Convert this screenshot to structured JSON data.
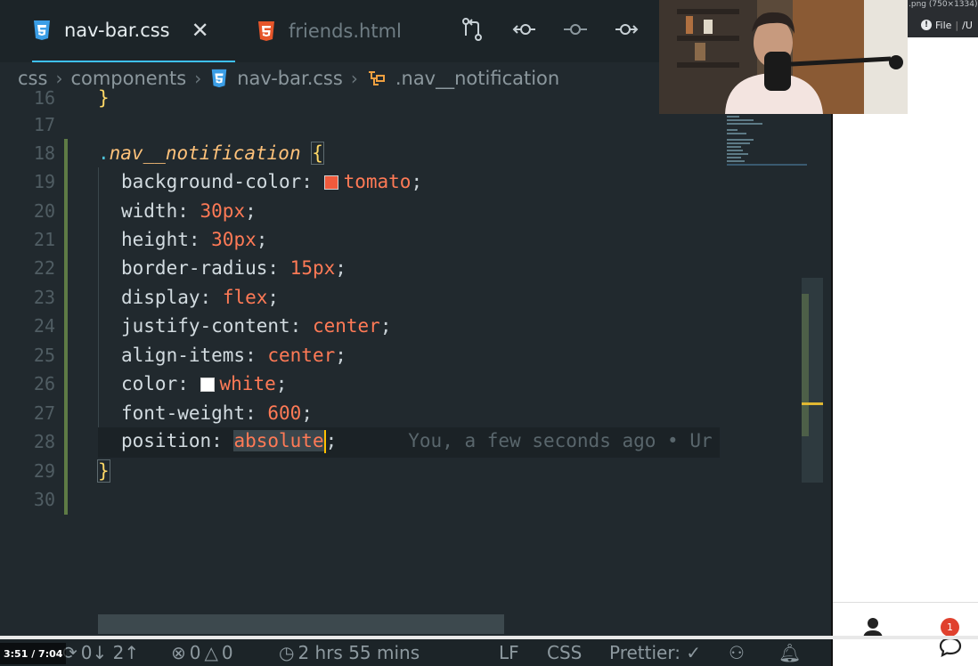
{
  "tabs": [
    {
      "label": "nav-bar.css",
      "active": true
    },
    {
      "label": "friends.html",
      "active": false
    }
  ],
  "breadcrumb": [
    "css",
    "components",
    "nav-bar.css",
    ".nav__notification"
  ],
  "code": {
    "partial_line_number": "16",
    "partial_line_text": "}",
    "lines": [
      {
        "n": "17"
      },
      {
        "n": "18",
        "selector_dot": ".",
        "selector": "nav__notification",
        "brace": "{"
      },
      {
        "n": "19",
        "prop": "background-color",
        "swatch": "#f05a3c",
        "value": "tomato"
      },
      {
        "n": "20",
        "prop": "width",
        "value": "30px"
      },
      {
        "n": "21",
        "prop": "height",
        "value": "30px"
      },
      {
        "n": "22",
        "prop": "border-radius",
        "value": "15px"
      },
      {
        "n": "23",
        "prop": "display",
        "value": "flex"
      },
      {
        "n": "24",
        "prop": "justify-content",
        "value": "center"
      },
      {
        "n": "25",
        "prop": "align-items",
        "value": "center"
      },
      {
        "n": "26",
        "prop": "color",
        "swatch": "#ffffff",
        "value": "white"
      },
      {
        "n": "27",
        "prop": "font-weight",
        "value": "600"
      },
      {
        "n": "28",
        "prop": "position",
        "value": "absolute",
        "blame": "You, a few seconds ago • Ur"
      },
      {
        "n": "29",
        "brace_close": "}"
      },
      {
        "n": "30"
      }
    ]
  },
  "statusbar": {
    "sync": "0↓ 2↑",
    "errors": "0",
    "warnings": "0",
    "time_tracked": "2 hrs 55 mins",
    "eol": "LF",
    "language": "CSS",
    "formatter": "Prettier: ✓"
  },
  "video": {
    "time": "3:51 / 7:04"
  },
  "browser": {
    "window_title": ".png (750×1334)",
    "url_label": "File",
    "url_path": "/U",
    "notification_count": "1"
  },
  "colors": {
    "accent": "#3ec1ff",
    "tomato": "#f05a3c",
    "value": "#ff7a56",
    "selector": "#ffc27a"
  }
}
